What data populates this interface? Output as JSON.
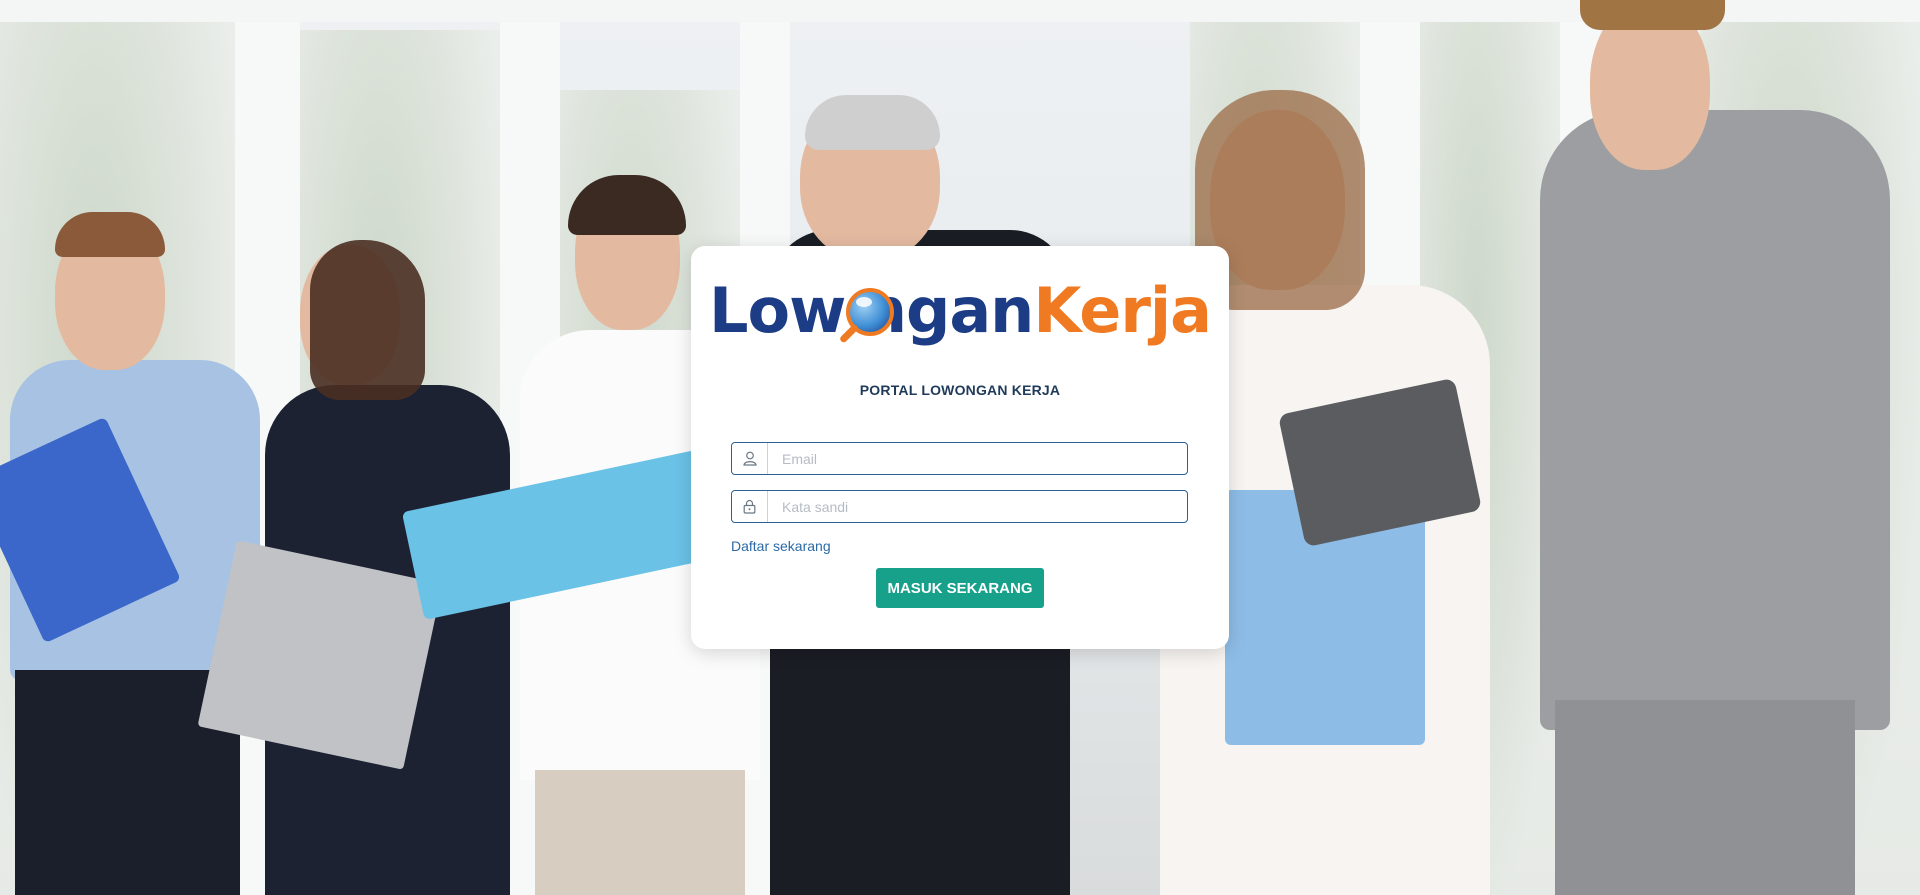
{
  "brand": {
    "logo_part1": "Low",
    "logo_part2": "ngan",
    "logo_part3": "Kerja",
    "subtitle": "PORTAL LOWONGAN KERJA",
    "colors": {
      "blue": "#1c3d86",
      "orange": "#f07a22"
    }
  },
  "form": {
    "email_placeholder": "Email",
    "password_placeholder": "Kata sandi",
    "email_icon": "user-icon",
    "password_icon": "lock-icon",
    "register_label": "Daftar sekarang",
    "submit_label": "MASUK SEKARANG",
    "submit_color": "#17a08a"
  },
  "background": {
    "description_icon": "office-team-photo"
  }
}
